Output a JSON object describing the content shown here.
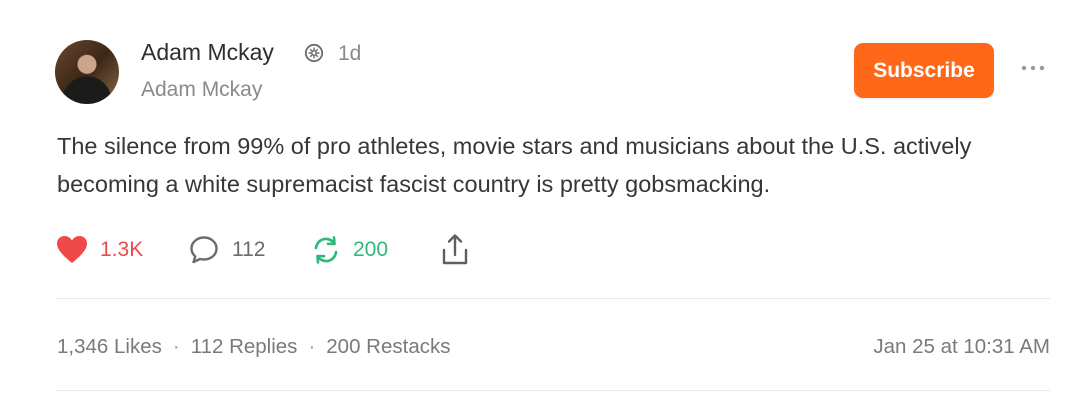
{
  "author": {
    "name": "Adam Mckay",
    "handle": "Adam Mckay",
    "time_ago": "1d",
    "verified_icon": "verified-badge-icon",
    "avatar_icon": "avatar"
  },
  "subscribe_button": {
    "label": "Subscribe",
    "color": "#ff6719"
  },
  "more_icon": "ellipsis-icon",
  "post": {
    "text": "The silence from 99% of pro athletes, movie stars and musicians about the U.S. actively becoming a white supremacist fascist country is pretty gobsmacking."
  },
  "actions": {
    "like": {
      "icon": "heart-icon",
      "count": "1.3K",
      "color": "#ee4a4a"
    },
    "reply": {
      "icon": "comment-icon",
      "count": "112"
    },
    "restack": {
      "icon": "restack-icon",
      "count": "200",
      "color": "#2fb87a"
    },
    "share": {
      "icon": "share-icon"
    }
  },
  "stats": {
    "likes": "1,346 Likes",
    "separator": "·",
    "replies": "112 Replies",
    "restacks": "200 Restacks",
    "date": "Jan 25 at 10:31 AM"
  }
}
